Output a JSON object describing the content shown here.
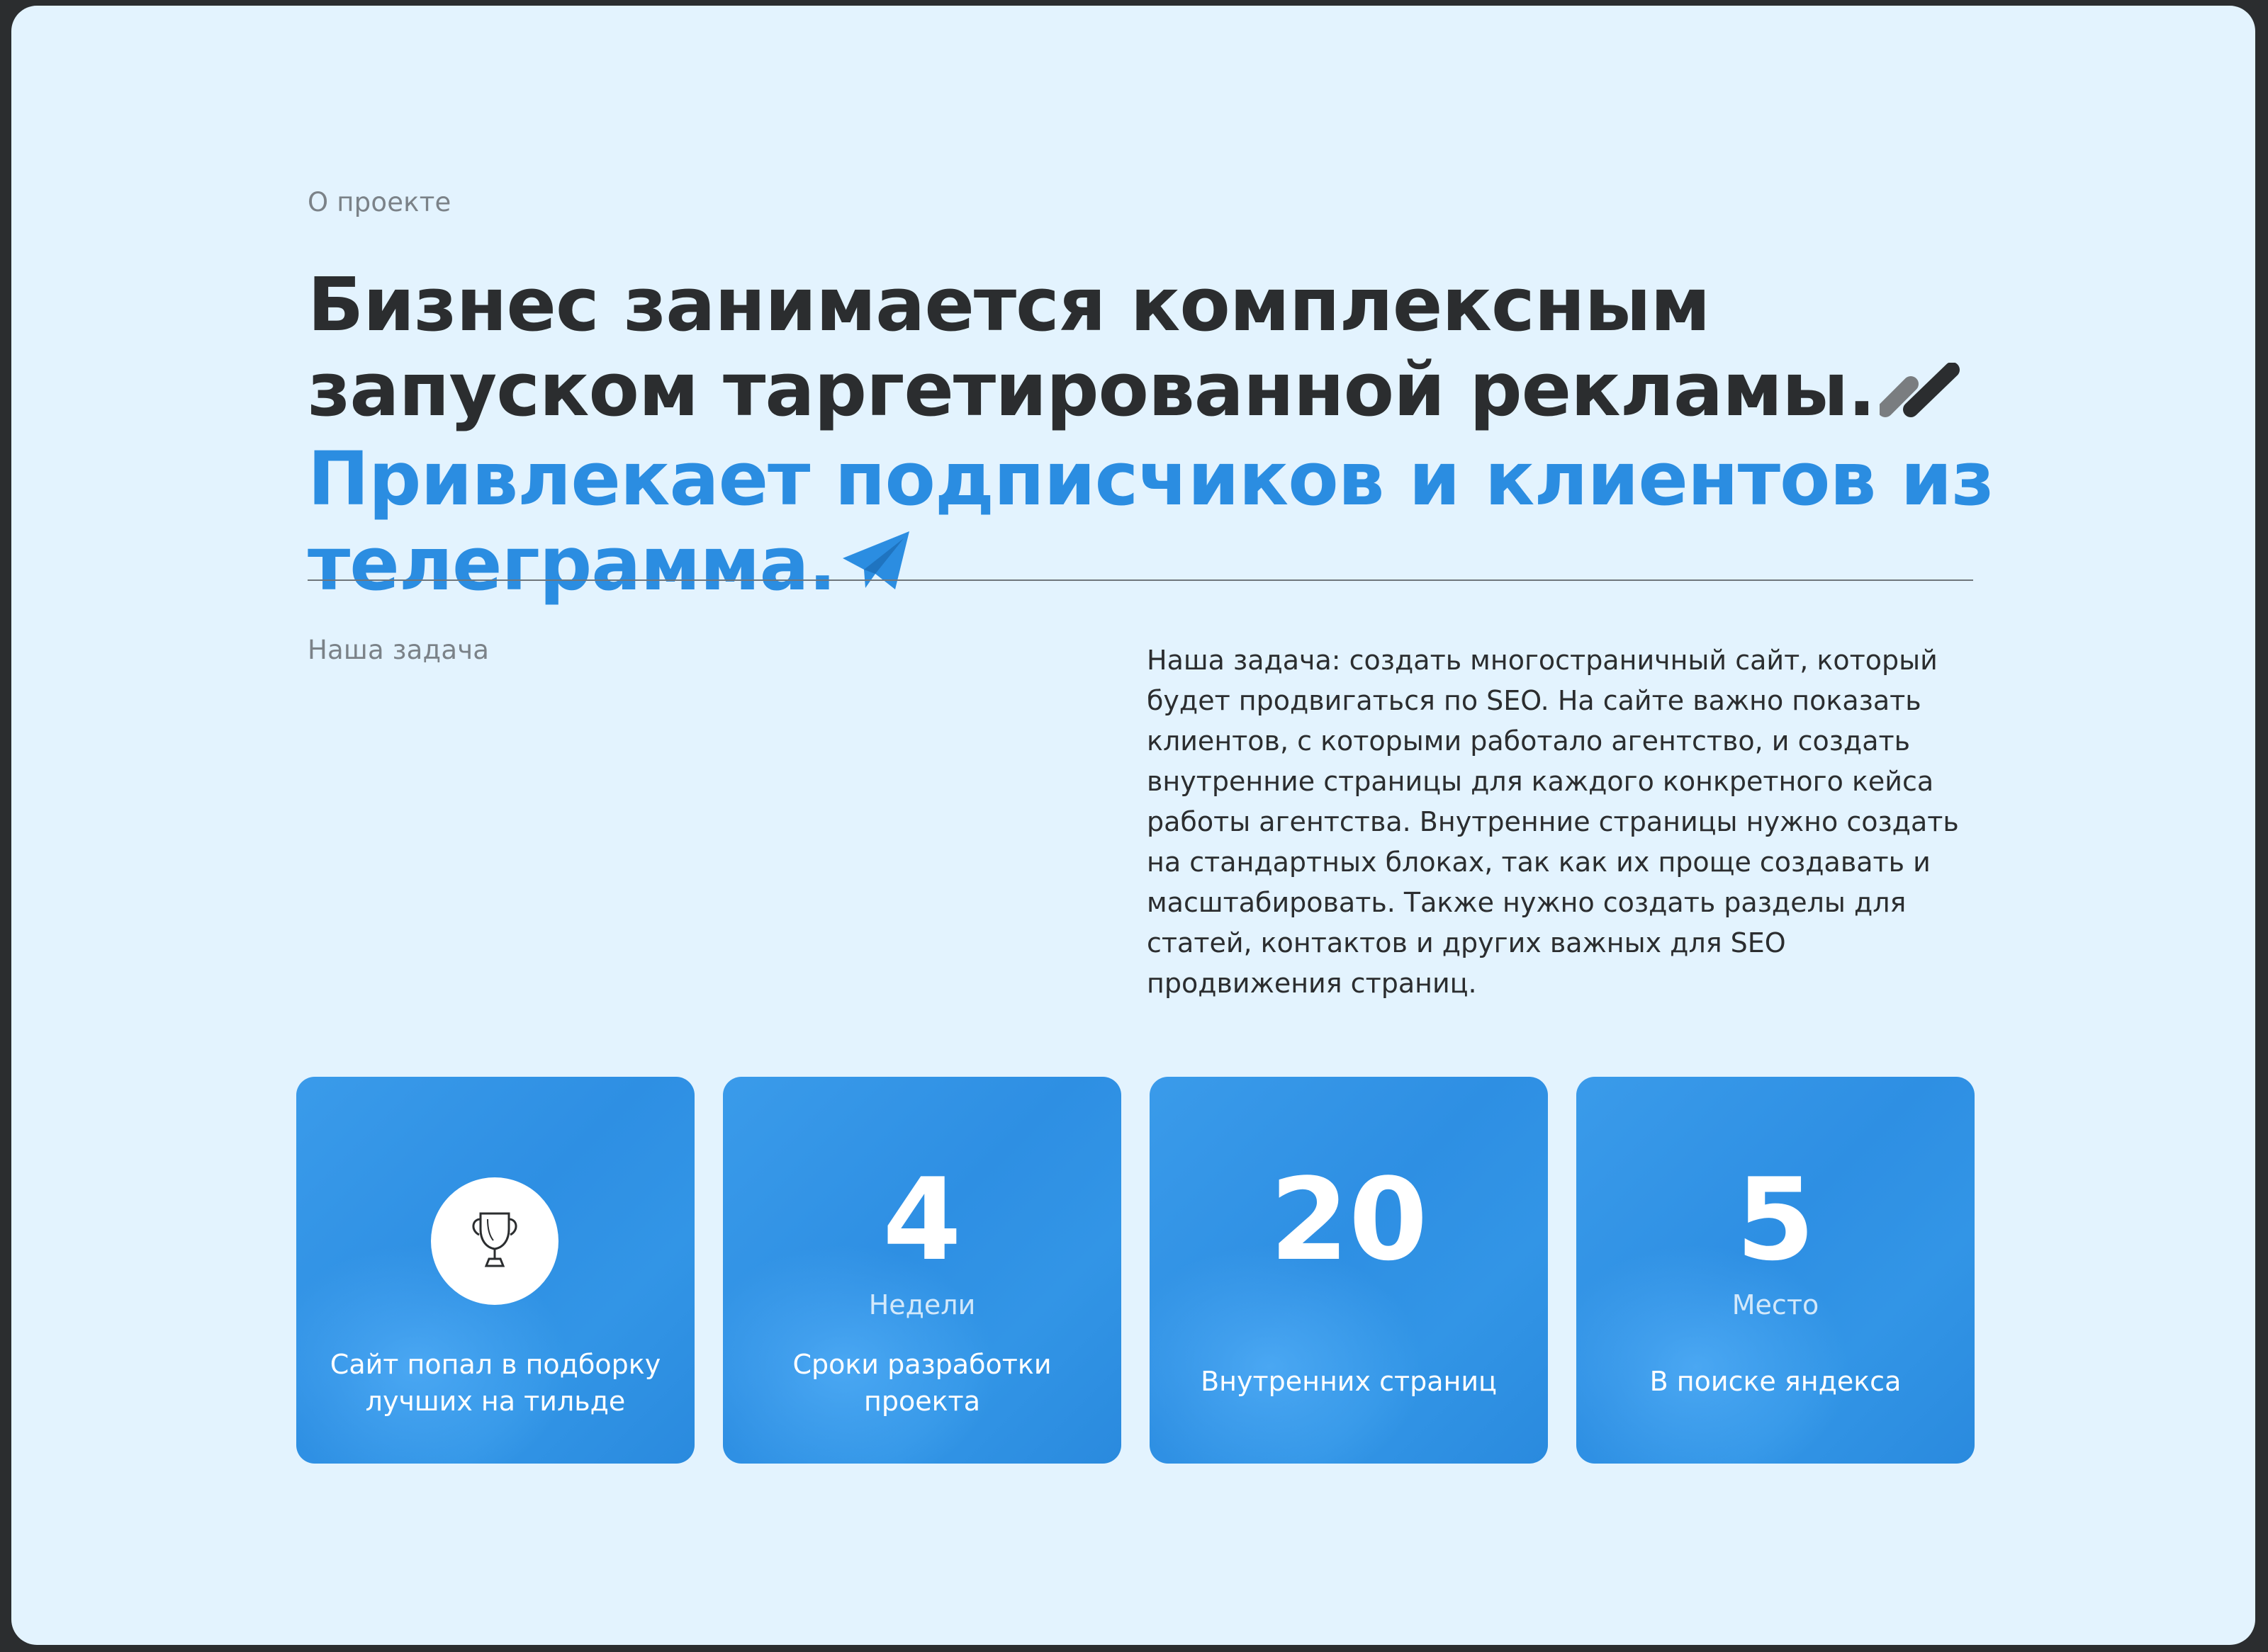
{
  "about": {
    "label": "О проекте",
    "headline_dark": "Бизнес занимается комплексным запуском таргетированной рекламы.",
    "headline_blue": "Привлекает подписчиков и клиентов из телеграмма."
  },
  "task": {
    "label": "Наша задача",
    "text": "Наша задача: создать многостраничный сайт, который будет продвигаться по SEO. На сайте важно показать клиентов, с которыми работало агентство, и создать внутренние страницы для каждого конкретного кейса работы агентства. Внутренние страницы нужно создать на стандартных блоках, так как их проще создавать и масштабировать. Также нужно создать разделы для статей, контактов и других важных для SEO продвижения страниц."
  },
  "stats": [
    {
      "icon": "trophy-icon",
      "caption": "Сайт попал в подборку лучших на тильде"
    },
    {
      "number": "4",
      "unit": "Недели",
      "caption": "Сроки разработки проекта"
    },
    {
      "number": "20",
      "caption": "Внутренних страниц"
    },
    {
      "number": "5",
      "unit": "Место",
      "caption": "В поиске яндекса"
    }
  ],
  "colors": {
    "page_background": "#e3f3fe",
    "accent_blue": "#2b8de1",
    "text_dark": "#2b2d2f",
    "card_blue": "#3295e6"
  }
}
